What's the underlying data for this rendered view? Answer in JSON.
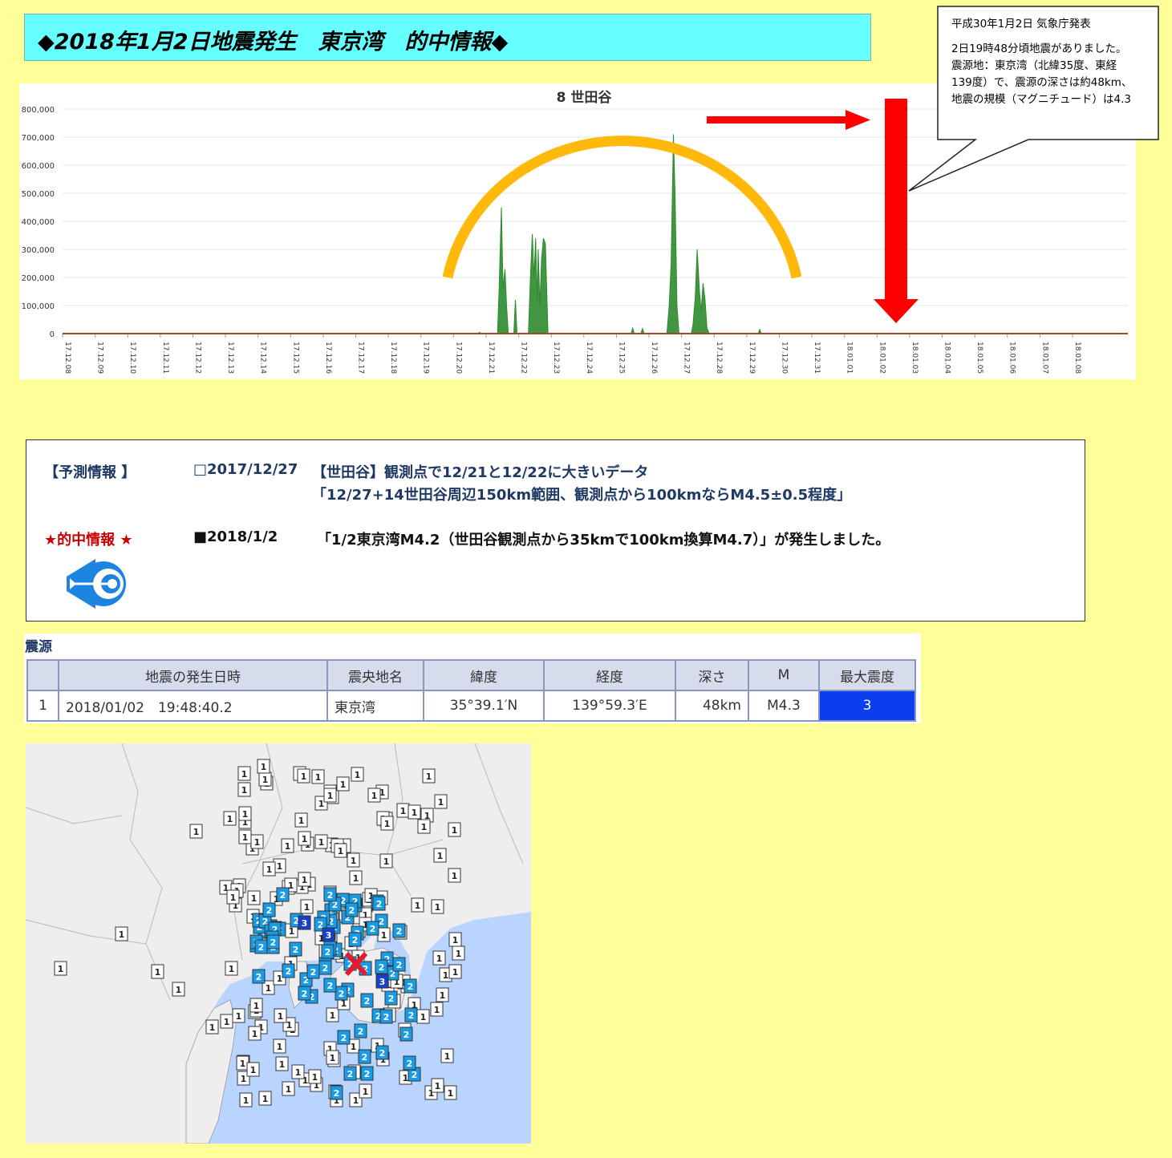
{
  "page": {
    "title": "◆2018年1月2日地震発生　東京湾　的中情報◆",
    "callout": {
      "line1": "平成30年1月2日 気象庁発表",
      "line2": "2日19時48分頃地震がありました。",
      "line3": "震源地：東京湾（北緯35度、東経",
      "line4": "139度）で、震源の深さは約48km、",
      "line5": "地震の規模（マグニチュード）は4.3"
    }
  },
  "chart_data": {
    "type": "area",
    "title": "8 世田谷",
    "ylim": [
      0,
      800000
    ],
    "yticks": [
      "800,000",
      "700,000",
      "600,000",
      "500,000",
      "400,000",
      "300,000",
      "200,000",
      "100,000",
      "0"
    ],
    "x_labels": [
      "17.12.08",
      "17.12.09",
      "17.12.10",
      "17.12.11",
      "17.12.12",
      "17.12.13",
      "17.12.14",
      "17.12.15",
      "17.12.16",
      "17.12.17",
      "17.12.18",
      "17.12.19",
      "17.12.20",
      "17.12.21",
      "17.12.22",
      "17.12.23",
      "17.12.24",
      "17.12.25",
      "17.12.26",
      "17.12.27",
      "17.12.28",
      "17.12.29",
      "17.12.30",
      "17.12.31",
      "18.01.01",
      "18.01.02",
      "18.01.03",
      "18.01.04",
      "18.01.05",
      "18.01.06",
      "18.01.07",
      "18.01.08"
    ],
    "x_days": [
      0,
      32.7
    ],
    "series": [
      {
        "color": "#2e8b2e",
        "points": [
          [
            12.75,
            0
          ],
          [
            12.8,
            5000
          ],
          [
            12.85,
            0
          ],
          [
            13.35,
            0
          ],
          [
            13.4,
            160000
          ],
          [
            13.47,
            450000
          ],
          [
            13.52,
            160000
          ],
          [
            13.58,
            230000
          ],
          [
            13.63,
            100000
          ],
          [
            13.68,
            0
          ],
          [
            13.85,
            0
          ],
          [
            13.9,
            120000
          ],
          [
            13.95,
            0
          ],
          [
            14.3,
            0
          ],
          [
            14.36,
            200000
          ],
          [
            14.42,
            355000
          ],
          [
            14.47,
            200000
          ],
          [
            14.52,
            340000
          ],
          [
            14.57,
            120000
          ],
          [
            14.6,
            300000
          ],
          [
            14.65,
            100000
          ],
          [
            14.7,
            260000
          ],
          [
            14.76,
            340000
          ],
          [
            14.82,
            320000
          ],
          [
            14.9,
            0
          ],
          [
            17.45,
            0
          ],
          [
            17.5,
            20000
          ],
          [
            17.55,
            0
          ],
          [
            17.75,
            0
          ],
          [
            17.8,
            18000
          ],
          [
            17.85,
            0
          ],
          [
            18.55,
            0
          ],
          [
            18.62,
            100000
          ],
          [
            18.68,
            250000
          ],
          [
            18.75,
            710000
          ],
          [
            18.8,
            500000
          ],
          [
            18.86,
            100000
          ],
          [
            18.92,
            0
          ],
          [
            19.3,
            0
          ],
          [
            19.35,
            30000
          ],
          [
            19.42,
            130000
          ],
          [
            19.48,
            300000
          ],
          [
            19.55,
            150000
          ],
          [
            19.6,
            80000
          ],
          [
            19.66,
            180000
          ],
          [
            19.72,
            120000
          ],
          [
            19.78,
            20000
          ],
          [
            19.85,
            0
          ],
          [
            21.35,
            0
          ],
          [
            21.4,
            15000
          ],
          [
            21.45,
            0
          ]
        ]
      }
    ],
    "baseline_color": "#a0462d"
  },
  "forecast": {
    "label1": "【予測情報 】",
    "date1": "□2017/12/27",
    "text1": "【世田谷】観測点で12/21と12/22に大きいデータ",
    "text2": "「12/27+14世田谷周辺150km範囲、観測点から100kmならM4.5±0.5程度」",
    "label2": "★的中情報 ★",
    "date2": "■2018/1/2",
    "text3": "「1/2東京湾M4.2（世田谷観測点から35kmで100km換算M4.7）」が発生しました。"
  },
  "quake": {
    "section_title": "震源",
    "headers": [
      "",
      "地震の発生日時",
      "震央地名",
      "緯度",
      "経度",
      "深さ",
      "M",
      "最大震度"
    ],
    "row": [
      "1",
      "2018/01/02　19:48:40.2",
      "東京湾",
      "35°39.1′N",
      "139°59.3′E",
      "48km",
      "M4.3",
      "3"
    ]
  },
  "map": {
    "colors": {
      "sea": "#b8d4ff",
      "land": "#eeeeee",
      "int1": "#ffffff",
      "int2": "#1a9be6",
      "int3": "#1a3fc8",
      "epicenter": "#e8192c"
    }
  }
}
